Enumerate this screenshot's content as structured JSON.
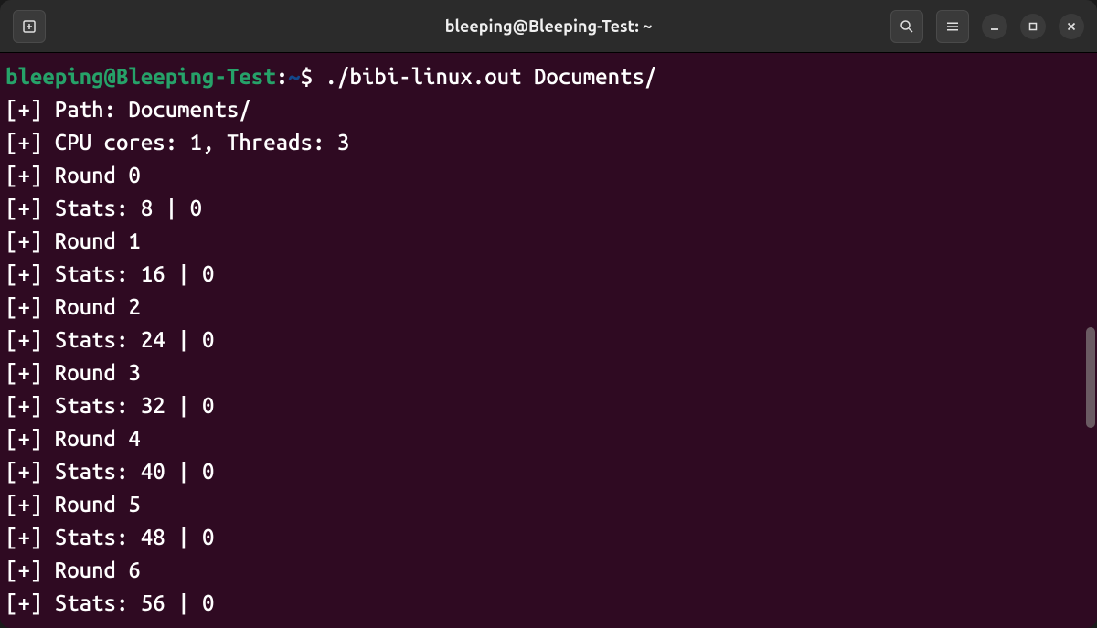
{
  "titlebar": {
    "title": "bleeping@Bleeping-Test: ~"
  },
  "prompt": {
    "user_host": "bleeping@Bleeping-Test",
    "separator": ":",
    "cwd": "~",
    "symbol": "$",
    "command": "./bibi-linux.out Documents/"
  },
  "output": [
    "[+] Path: Documents/",
    "[+] CPU cores: 1, Threads: 3",
    "[+] Round 0",
    "[+] Stats: 8 | 0",
    "[+] Round 1",
    "[+] Stats: 16 | 0",
    "[+] Round 2",
    "[+] Stats: 24 | 0",
    "[+] Round 3",
    "[+] Stats: 32 | 0",
    "[+] Round 4",
    "[+] Stats: 40 | 0",
    "[+] Round 5",
    "[+] Stats: 48 | 0",
    "[+] Round 6",
    "[+] Stats: 56 | 0"
  ]
}
